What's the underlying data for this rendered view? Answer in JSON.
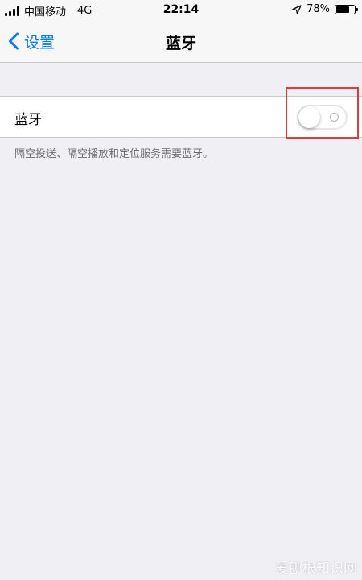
{
  "status_bar": {
    "carrier": "中国移动",
    "network": "4G",
    "time": "22:14",
    "battery_text": "78%",
    "battery_level": 0.78,
    "signal_icon": "cellular-signal-icon",
    "location_icon": "location-arrow-icon",
    "battery_icon": "battery-icon"
  },
  "nav": {
    "back_label": "设置",
    "title": "蓝牙",
    "back_icon": "chevron-left-icon"
  },
  "bluetooth": {
    "label": "蓝牙",
    "enabled": false
  },
  "footer_note": "隔空投送、隔空播放和定位服务需要蓝牙。",
  "watermark": "爱刨根知识网",
  "colors": {
    "accent": "#007aff",
    "background": "#efeff4",
    "highlight": "#e03b3b"
  }
}
